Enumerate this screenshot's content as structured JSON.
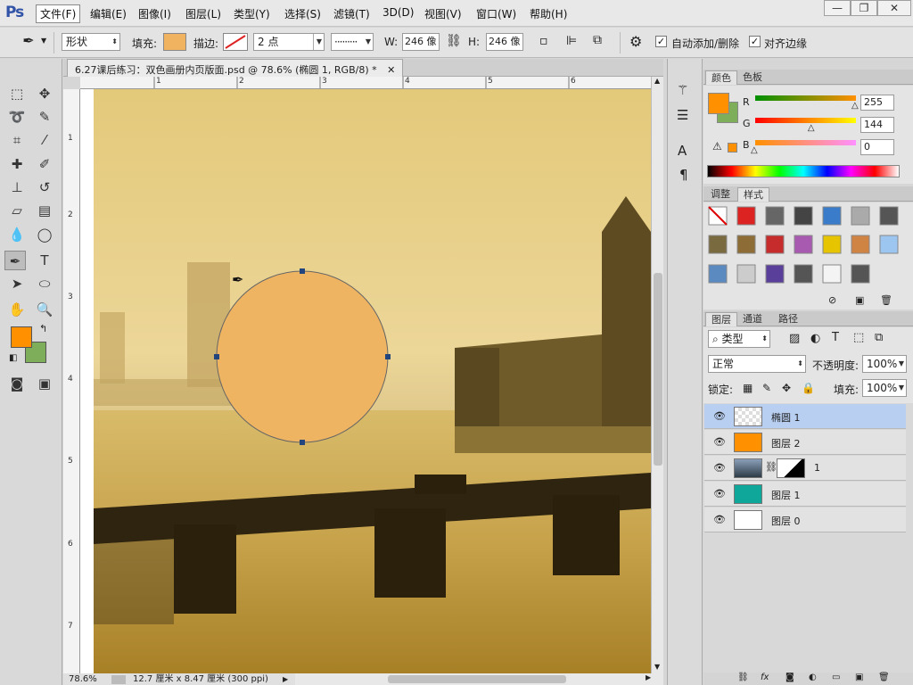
{
  "app": {
    "logo": "Ps"
  },
  "menu": [
    "文件(F)",
    "编辑(E)",
    "图像(I)",
    "图层(L)",
    "类型(Y)",
    "选择(S)",
    "滤镜(T)",
    "3D(D)",
    "视图(V)",
    "窗口(W)",
    "帮助(H)"
  ],
  "window_controls": {
    "minimize": "—",
    "restore": "❐",
    "close": "✕"
  },
  "options": {
    "shape_mode": "形状",
    "fill_label": "填充:",
    "fill_color": "#f0b461",
    "stroke_label": "描边:",
    "stroke_width": "2 点",
    "w_label": "W:",
    "w_value": "246 像",
    "h_label": "H:",
    "h_value": "246 像",
    "auto_add_label": "自动添加/删除",
    "align_edges_label": "对齐边缘"
  },
  "document": {
    "tab_title": "6.27课后练习：双色画册内页版面.psd @ 78.6% (椭圆 1, RGB/8) *",
    "zoom": "78.6%",
    "doc_info": "12.7 厘米 x 8.47 厘米 (300 ppi)",
    "ruler_top": [
      "1",
      "2",
      "3",
      "4",
      "5",
      "6"
    ],
    "ruler_left": [
      "1",
      "2",
      "3",
      "4",
      "5",
      "6",
      "7"
    ]
  },
  "color_panel": {
    "tabs": [
      "颜色",
      "色板"
    ],
    "r_label": "R",
    "g_label": "G",
    "b_label": "B",
    "r": "255",
    "g": "144",
    "b": "0",
    "r_level": 1.0,
    "g_level": 0.565,
    "b_level": 0.0,
    "fg_color": "#ff9000",
    "bg_color": "#7fae5b"
  },
  "styles_panel": {
    "tabs": [
      "调整",
      "样式"
    ]
  },
  "layers_panel": {
    "tabs": [
      "图层",
      "通道",
      "路径"
    ],
    "filter_kind": "类型",
    "blend_mode": "正常",
    "opacity_label": "不透明度:",
    "opacity": "100%",
    "lock_label": "锁定:",
    "fill_label": "填充:",
    "fill": "100%",
    "layers": [
      {
        "name": "椭圆 1",
        "selected": true
      },
      {
        "name": "图层 2",
        "selected": false
      },
      {
        "name": "1",
        "selected": false
      },
      {
        "name": "图层 1",
        "selected": false
      },
      {
        "name": "图层 0",
        "selected": false
      }
    ]
  }
}
